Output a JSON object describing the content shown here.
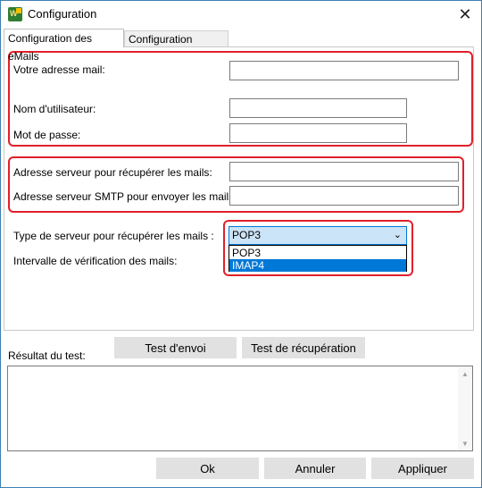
{
  "window": {
    "title": "Configuration",
    "close_glyph": "✕",
    "app_icon_letter": "W"
  },
  "tabs": [
    {
      "label": "Configuration des eMails"
    },
    {
      "label": "Configuration avancée"
    }
  ],
  "form": {
    "email_label": "Votre adresse mail:",
    "email_value": "",
    "username_label": "Nom d'utilisateur:",
    "username_value": "",
    "password_label": "Mot de passe:",
    "password_value": "",
    "incoming_server_label": "Adresse serveur pour récupérer les mails:",
    "incoming_server_value": "",
    "smtp_server_label": "Adresse serveur SMTP pour envoyer les mails:",
    "smtp_server_value": "",
    "server_type_label": "Type de serveur pour récupérer les mails :",
    "server_type_selected": "POP3",
    "server_type_options": [
      "POP3",
      "IMAP4"
    ],
    "check_interval_label": "Intervalle de vérification des mails:"
  },
  "test": {
    "result_label": "Résultat du test:",
    "send_test_button": "Test d'envoi",
    "receive_test_button": "Test de récupération"
  },
  "footer": {
    "ok_button": "Ok",
    "cancel_button": "Annuler",
    "apply_button": "Appliquer"
  },
  "colors": {
    "highlight": "#e0202a",
    "selection": "#0078d7",
    "button_face": "#e1e1e1"
  }
}
